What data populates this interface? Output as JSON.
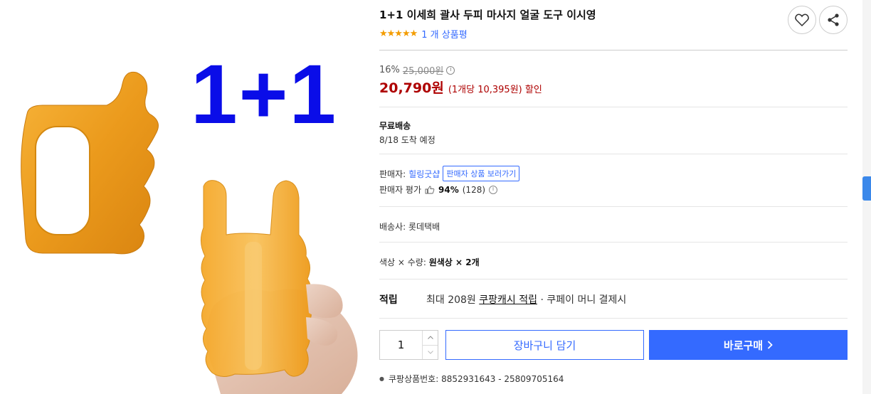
{
  "product": {
    "image_overlay_text": "1+1",
    "title": "1+1 이세희 괄사 두피 마사지 얼굴 도구 이시영",
    "stars": "★★★★★",
    "review_count": "1 개 상품평"
  },
  "price": {
    "discount_pct": "16%",
    "original": "25,000원",
    "sale": "20,790원",
    "unit_price": "(1개당 10,395원) 할인"
  },
  "shipping": {
    "label": "무료배송",
    "arrival": "8/18 도착 예정"
  },
  "seller": {
    "label": "판매자:",
    "name": "힐링굿샵",
    "more_button": "판매자 상품 보러가기",
    "rating_label": "판매자 평가",
    "rating_pct": "94%",
    "rating_count": "(128)"
  },
  "courier": {
    "text": "배송사:  롯데택배"
  },
  "option": {
    "label": "색상 × 수량:",
    "value": "원색상 × 2개"
  },
  "points": {
    "label": "적립",
    "text_before": "최대 208원 ",
    "link": "쿠팡캐시 적립",
    "text_after": " · 쿠페이 머니 결제시"
  },
  "purchase": {
    "quantity": "1",
    "cart_button": "장바구니 담기",
    "buy_button": "바로구매"
  },
  "product_number": {
    "text": "쿠팡상품번호: 8852931643 - 25809705164"
  },
  "colors": {
    "accent": "#346aff",
    "price": "#ae0000",
    "star": "#f39c00",
    "overlay_text": "#0a0de8",
    "gua_sha": "#f0a020"
  }
}
